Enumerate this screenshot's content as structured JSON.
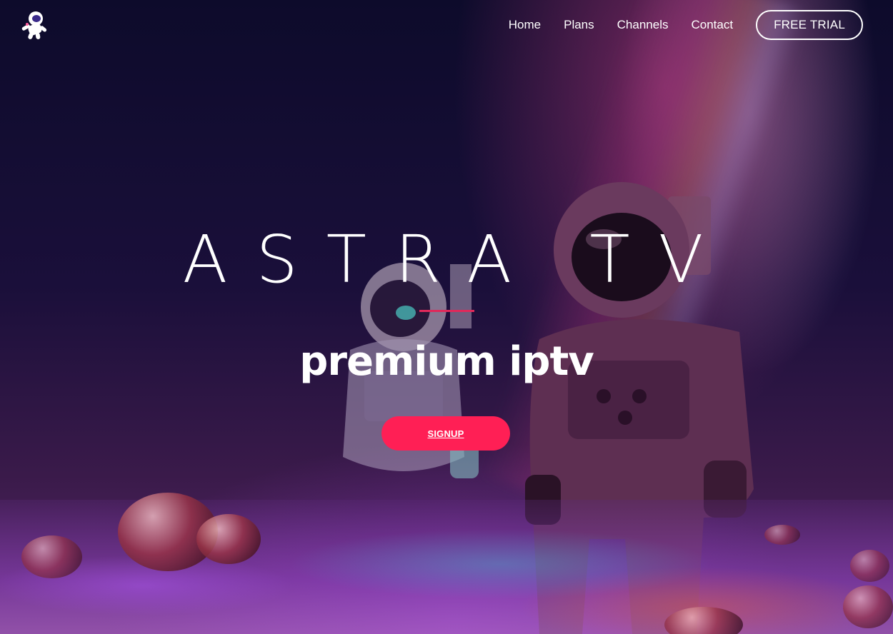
{
  "nav": {
    "items": [
      {
        "label": "Home"
      },
      {
        "label": "Plans"
      },
      {
        "label": "Channels"
      },
      {
        "label": "Contact"
      }
    ],
    "cta_label": "FREE TRIAL"
  },
  "hero": {
    "title": "ASTRA TV",
    "subtitle": "premium iptv",
    "signup_label": "SIGNUP"
  },
  "colors": {
    "accent": "#ff1f55",
    "underline": "#e0295a",
    "background": "#0b0a22"
  },
  "icons": {
    "logo": "astronaut-logo-icon"
  }
}
